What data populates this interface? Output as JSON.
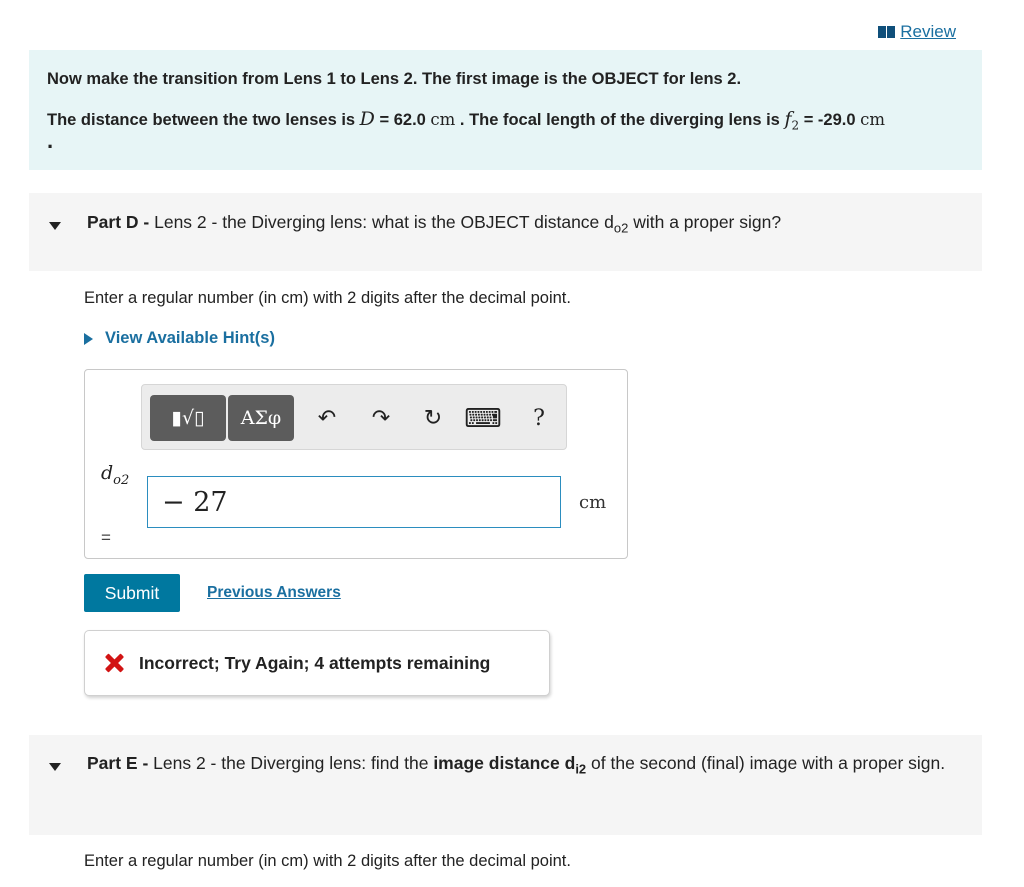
{
  "header": {
    "review_label": "Review"
  },
  "intro": {
    "line1": "Now make the transition from Lens 1 to Lens 2. The first image is the OBJECT for lens 2.",
    "line2_pre": "The distance between the two lenses is ",
    "D_symbol": "D",
    "D_value": " = 62.0 ",
    "D_unit": "cm",
    "line2_mid": " . The focal length of the diverging lens is ",
    "f_symbol": "f",
    "f_sub": "2",
    "f_value": " = -29.0 ",
    "f_unit": "cm",
    "line3": "."
  },
  "part_d": {
    "label": "Part D - ",
    "title_pre": "Lens 2 - the Diverging lens: what is the OBJECT distance d",
    "title_sub": "o2",
    "title_post": " with a proper sign?",
    "instruction": "Enter a regular number (in cm) with 2 digits after the decimal point.",
    "hint_label": "View Available Hint(s)",
    "toolbar": {
      "templates_label": "▮√▯",
      "greek_label": "ΑΣφ",
      "undo_icon": "↶",
      "redo_icon": "↷",
      "reset_icon": "↻",
      "keyboard_icon": "⌨",
      "help_icon": "?"
    },
    "var_name": "d",
    "var_sub": "o2",
    "equals": "=",
    "input_value": "− 27",
    "unit": "cm",
    "submit_label": "Submit",
    "previous_answers_label": "Previous Answers",
    "feedback": "Incorrect; Try Again; 4 attempts remaining"
  },
  "part_e": {
    "label": "Part E - ",
    "title_pre": "Lens 2 - the Diverging lens: find the ",
    "title_bold": "image distance d",
    "title_sub": "i2",
    "title_post": " of the second (final) image with a proper sign.",
    "instruction": "Enter a regular number (in cm) with 2 digits after the decimal point."
  },
  "colors": {
    "accent": "#00789f",
    "link": "#1a6fa0",
    "intro_bg": "#e7f5f6",
    "error": "#d21414"
  }
}
